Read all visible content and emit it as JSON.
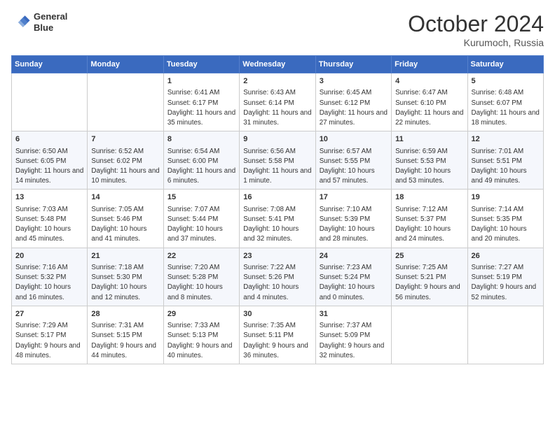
{
  "header": {
    "logo_line1": "General",
    "logo_line2": "Blue",
    "month_year": "October 2024",
    "location": "Kurumoch, Russia"
  },
  "days_of_week": [
    "Sunday",
    "Monday",
    "Tuesday",
    "Wednesday",
    "Thursday",
    "Friday",
    "Saturday"
  ],
  "weeks": [
    [
      {
        "day": "",
        "detail": ""
      },
      {
        "day": "",
        "detail": ""
      },
      {
        "day": "1",
        "detail": "Sunrise: 6:41 AM\nSunset: 6:17 PM\nDaylight: 11 hours and 35 minutes."
      },
      {
        "day": "2",
        "detail": "Sunrise: 6:43 AM\nSunset: 6:14 PM\nDaylight: 11 hours and 31 minutes."
      },
      {
        "day": "3",
        "detail": "Sunrise: 6:45 AM\nSunset: 6:12 PM\nDaylight: 11 hours and 27 minutes."
      },
      {
        "day": "4",
        "detail": "Sunrise: 6:47 AM\nSunset: 6:10 PM\nDaylight: 11 hours and 22 minutes."
      },
      {
        "day": "5",
        "detail": "Sunrise: 6:48 AM\nSunset: 6:07 PM\nDaylight: 11 hours and 18 minutes."
      }
    ],
    [
      {
        "day": "6",
        "detail": "Sunrise: 6:50 AM\nSunset: 6:05 PM\nDaylight: 11 hours and 14 minutes."
      },
      {
        "day": "7",
        "detail": "Sunrise: 6:52 AM\nSunset: 6:02 PM\nDaylight: 11 hours and 10 minutes."
      },
      {
        "day": "8",
        "detail": "Sunrise: 6:54 AM\nSunset: 6:00 PM\nDaylight: 11 hours and 6 minutes."
      },
      {
        "day": "9",
        "detail": "Sunrise: 6:56 AM\nSunset: 5:58 PM\nDaylight: 11 hours and 1 minute."
      },
      {
        "day": "10",
        "detail": "Sunrise: 6:57 AM\nSunset: 5:55 PM\nDaylight: 10 hours and 57 minutes."
      },
      {
        "day": "11",
        "detail": "Sunrise: 6:59 AM\nSunset: 5:53 PM\nDaylight: 10 hours and 53 minutes."
      },
      {
        "day": "12",
        "detail": "Sunrise: 7:01 AM\nSunset: 5:51 PM\nDaylight: 10 hours and 49 minutes."
      }
    ],
    [
      {
        "day": "13",
        "detail": "Sunrise: 7:03 AM\nSunset: 5:48 PM\nDaylight: 10 hours and 45 minutes."
      },
      {
        "day": "14",
        "detail": "Sunrise: 7:05 AM\nSunset: 5:46 PM\nDaylight: 10 hours and 41 minutes."
      },
      {
        "day": "15",
        "detail": "Sunrise: 7:07 AM\nSunset: 5:44 PM\nDaylight: 10 hours and 37 minutes."
      },
      {
        "day": "16",
        "detail": "Sunrise: 7:08 AM\nSunset: 5:41 PM\nDaylight: 10 hours and 32 minutes."
      },
      {
        "day": "17",
        "detail": "Sunrise: 7:10 AM\nSunset: 5:39 PM\nDaylight: 10 hours and 28 minutes."
      },
      {
        "day": "18",
        "detail": "Sunrise: 7:12 AM\nSunset: 5:37 PM\nDaylight: 10 hours and 24 minutes."
      },
      {
        "day": "19",
        "detail": "Sunrise: 7:14 AM\nSunset: 5:35 PM\nDaylight: 10 hours and 20 minutes."
      }
    ],
    [
      {
        "day": "20",
        "detail": "Sunrise: 7:16 AM\nSunset: 5:32 PM\nDaylight: 10 hours and 16 minutes."
      },
      {
        "day": "21",
        "detail": "Sunrise: 7:18 AM\nSunset: 5:30 PM\nDaylight: 10 hours and 12 minutes."
      },
      {
        "day": "22",
        "detail": "Sunrise: 7:20 AM\nSunset: 5:28 PM\nDaylight: 10 hours and 8 minutes."
      },
      {
        "day": "23",
        "detail": "Sunrise: 7:22 AM\nSunset: 5:26 PM\nDaylight: 10 hours and 4 minutes."
      },
      {
        "day": "24",
        "detail": "Sunrise: 7:23 AM\nSunset: 5:24 PM\nDaylight: 10 hours and 0 minutes."
      },
      {
        "day": "25",
        "detail": "Sunrise: 7:25 AM\nSunset: 5:21 PM\nDaylight: 9 hours and 56 minutes."
      },
      {
        "day": "26",
        "detail": "Sunrise: 7:27 AM\nSunset: 5:19 PM\nDaylight: 9 hours and 52 minutes."
      }
    ],
    [
      {
        "day": "27",
        "detail": "Sunrise: 7:29 AM\nSunset: 5:17 PM\nDaylight: 9 hours and 48 minutes."
      },
      {
        "day": "28",
        "detail": "Sunrise: 7:31 AM\nSunset: 5:15 PM\nDaylight: 9 hours and 44 minutes."
      },
      {
        "day": "29",
        "detail": "Sunrise: 7:33 AM\nSunset: 5:13 PM\nDaylight: 9 hours and 40 minutes."
      },
      {
        "day": "30",
        "detail": "Sunrise: 7:35 AM\nSunset: 5:11 PM\nDaylight: 9 hours and 36 minutes."
      },
      {
        "day": "31",
        "detail": "Sunrise: 7:37 AM\nSunset: 5:09 PM\nDaylight: 9 hours and 32 minutes."
      },
      {
        "day": "",
        "detail": ""
      },
      {
        "day": "",
        "detail": ""
      }
    ]
  ]
}
